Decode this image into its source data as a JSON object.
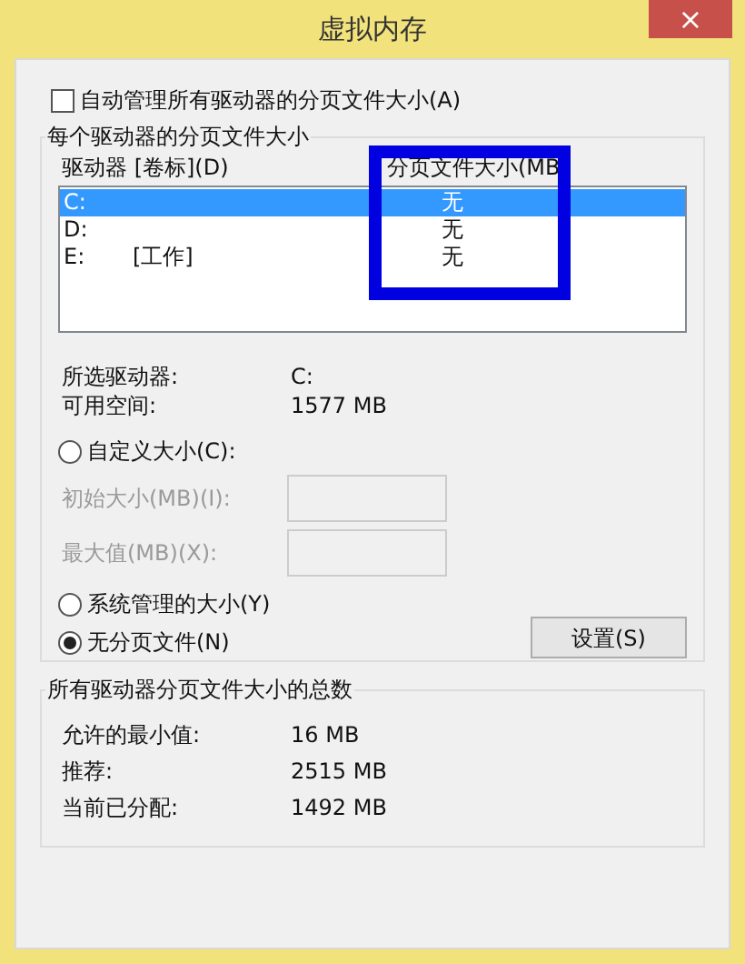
{
  "window": {
    "title": "虚拟内存",
    "close": "×"
  },
  "auto_manage": {
    "label": "自动管理所有驱动器的分页文件大小(A)",
    "checked": false
  },
  "per_drive": {
    "title": "每个驱动器的分页文件大小",
    "columns": [
      "驱动器 [卷标](D)",
      "分页文件大小(MB"
    ],
    "drives": [
      {
        "drive": "C:",
        "size": "无",
        "selected": true
      },
      {
        "drive": "D:",
        "size": "无",
        "selected": false
      },
      {
        "drive": "E:",
        "label": "[工作]",
        "size": "无",
        "selected": false
      }
    ],
    "info": [
      {
        "label": "所选驱动器:",
        "value": "C:"
      },
      {
        "label": "可用空间:",
        "value": "1577 MB"
      }
    ],
    "custom": {
      "label": "自定义大小(C):",
      "selected": false
    },
    "fields": [
      {
        "label": "初始大小(MB)(I):",
        "disabled": true
      },
      {
        "label": "最大值(MB)(X):",
        "disabled": true
      }
    ],
    "system": {
      "label": "系统管理的大小(Y)",
      "selected": false
    },
    "none": {
      "label": "无分页文件(N)",
      "selected": true
    },
    "set_button": "设置(S)"
  },
  "totals": {
    "title": "所有驱动器分页文件大小的总数",
    "rows": [
      {
        "label": "允许的最小值:",
        "value": "16 MB"
      },
      {
        "label": "推荐:",
        "value": "2515 MB"
      },
      {
        "label": "当前已分配:",
        "value": "1492 MB"
      }
    ]
  }
}
